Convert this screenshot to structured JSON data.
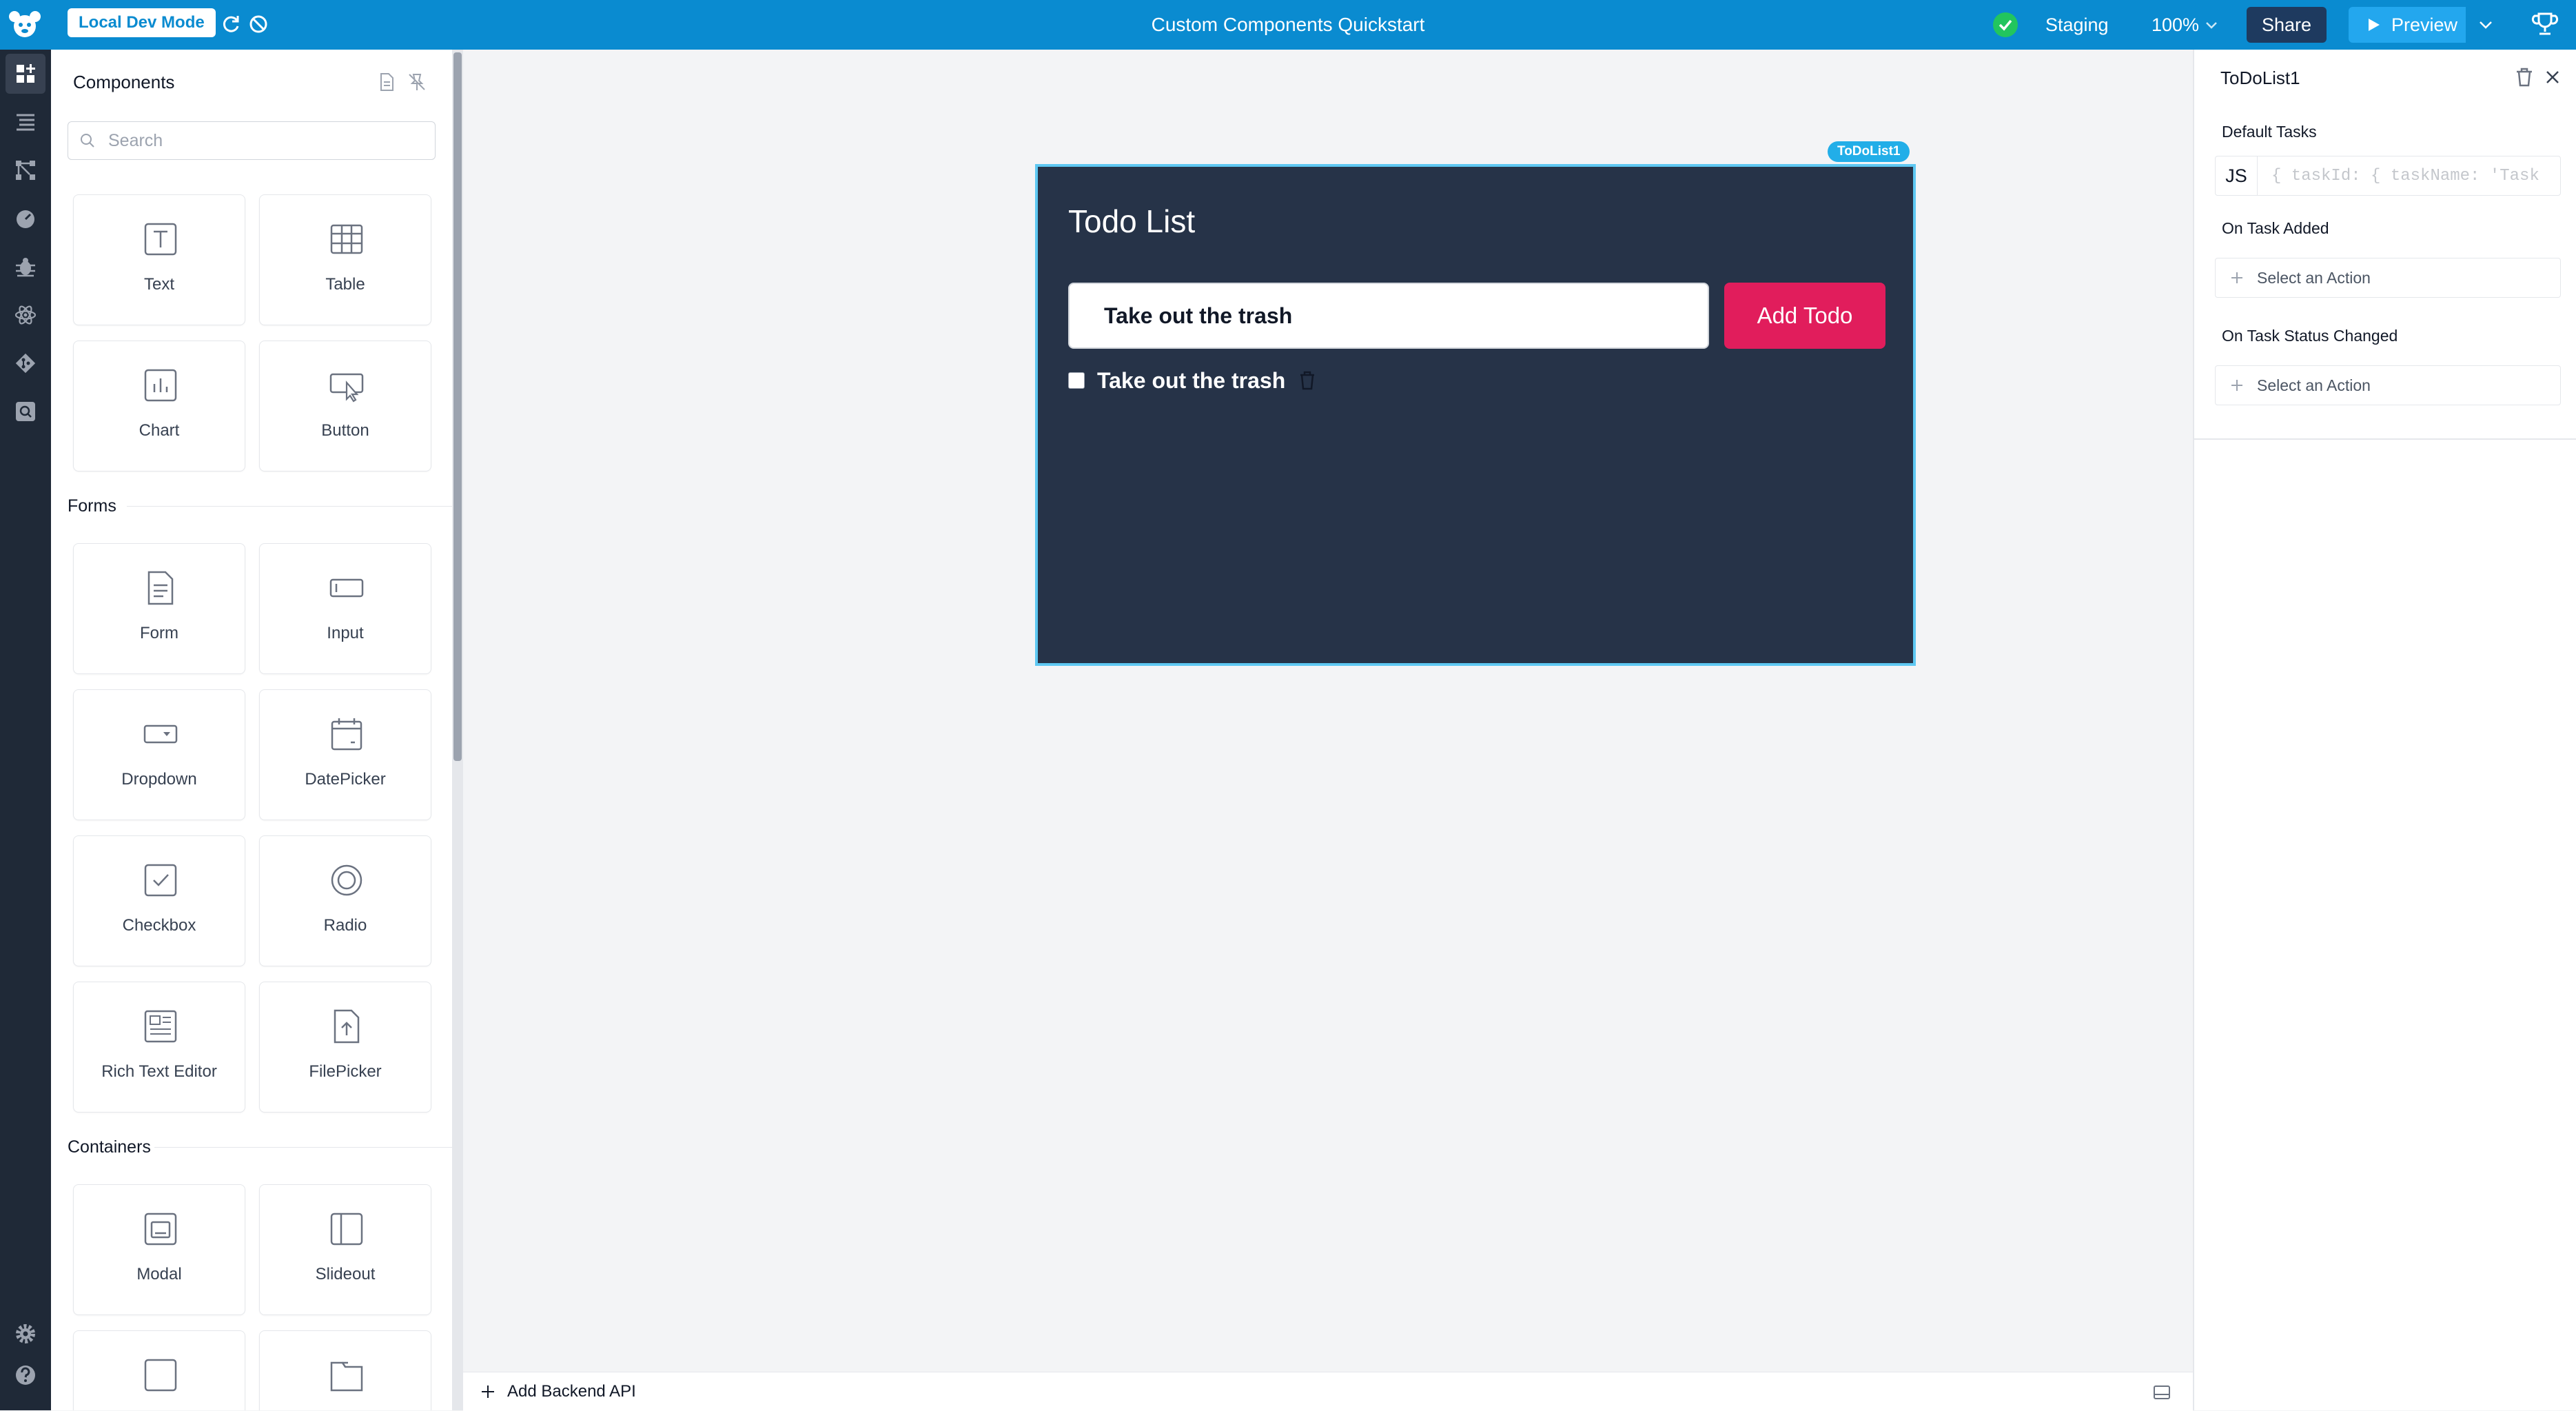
{
  "header": {
    "mode_badge": "Local Dev Mode",
    "app_title": "Custom Components Quickstart",
    "environment": "Staging",
    "zoom": "100%",
    "share_label": "Share",
    "preview_label": "Preview"
  },
  "components_panel": {
    "title": "Components",
    "search_placeholder": "Search",
    "sections": {
      "forms": "Forms",
      "containers": "Containers"
    },
    "tiles": {
      "text": "Text",
      "table": "Table",
      "chart": "Chart",
      "button": "Button",
      "form": "Form",
      "input": "Input",
      "dropdown": "Dropdown",
      "datepicker": "DatePicker",
      "checkbox": "Checkbox",
      "radio": "Radio",
      "rich_text_editor": "Rich Text Editor",
      "filepicker": "FilePicker",
      "modal": "Modal",
      "slideout": "Slideout"
    }
  },
  "canvas": {
    "component_tag": "ToDoList1",
    "todo": {
      "title": "Todo List",
      "input_value": "Take out the trash",
      "add_button": "Add Todo",
      "items": [
        {
          "text": "Take out the trash",
          "checked": false
        }
      ]
    },
    "bottom_bar": {
      "add_backend_label": "Add Backend API"
    }
  },
  "inspector": {
    "title": "ToDoList1",
    "default_tasks_label": "Default Tasks",
    "js_label": "JS",
    "default_tasks_code": "{ taskId: { taskName: 'Task",
    "on_task_added_label": "On Task Added",
    "on_task_added_action": "Select an Action",
    "on_task_status_changed_label": "On Task Status Changed",
    "on_task_status_changed_action": "Select an Action"
  },
  "colors": {
    "topbar": "#0a8bd0",
    "rail": "#1f2937",
    "todo_background": "#263348",
    "todo_accent": "#e11d5c",
    "selection": "#5ec8f2"
  }
}
